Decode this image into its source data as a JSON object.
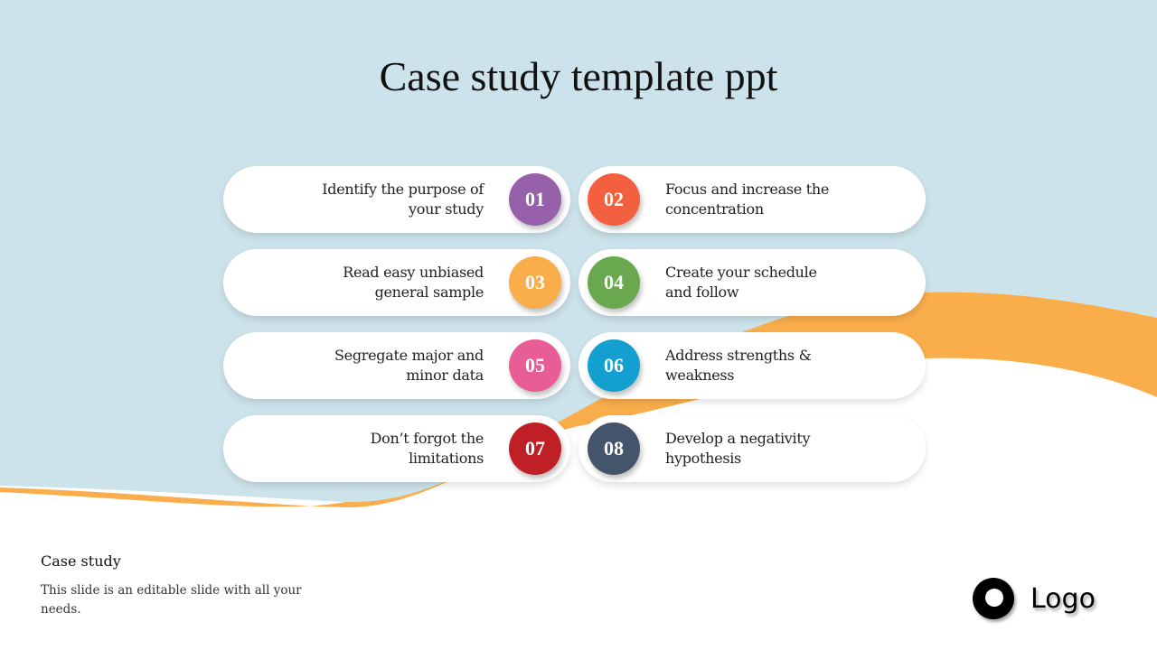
{
  "slide": {
    "title": "Case study template ppt",
    "background_color": "#cde3eb",
    "accent_color": "#f9ad4b"
  },
  "steps": [
    {
      "number": "01",
      "text_line1": "Identify the purpose of",
      "text_line2": "your study",
      "color": "#9660ab",
      "side": "left"
    },
    {
      "number": "02",
      "text_line1": "Focus and increase the",
      "text_line2": "concentration",
      "color": "#f2603f",
      "side": "right"
    },
    {
      "number": "03",
      "text_line1": "Read easy unbiased",
      "text_line2": "general sample",
      "color": "#f9ad4b",
      "side": "left"
    },
    {
      "number": "04",
      "text_line1": "Create your schedule",
      "text_line2": "and follow",
      "color": "#6aa84f",
      "side": "right"
    },
    {
      "number": "05",
      "text_line1": "Segregate major and",
      "text_line2": "minor data",
      "color": "#e85d96",
      "side": "left"
    },
    {
      "number": "06",
      "text_line1": "Address strengths &",
      "text_line2": "weakness",
      "color": "#139fd0",
      "side": "right"
    },
    {
      "number": "07",
      "text_line1": "Don’t forgot the",
      "text_line2": "limitations",
      "color": "#bf2026",
      "side": "left"
    },
    {
      "number": "08",
      "text_line1": "Develop a negativity",
      "text_line2": "hypothesis",
      "color": "#44546a",
      "side": "right"
    }
  ],
  "footer": {
    "title": "Case study",
    "description": "This slide is an editable slide with all your needs."
  },
  "logo": {
    "icon": "logo-ring-icon",
    "text": "Logo"
  }
}
